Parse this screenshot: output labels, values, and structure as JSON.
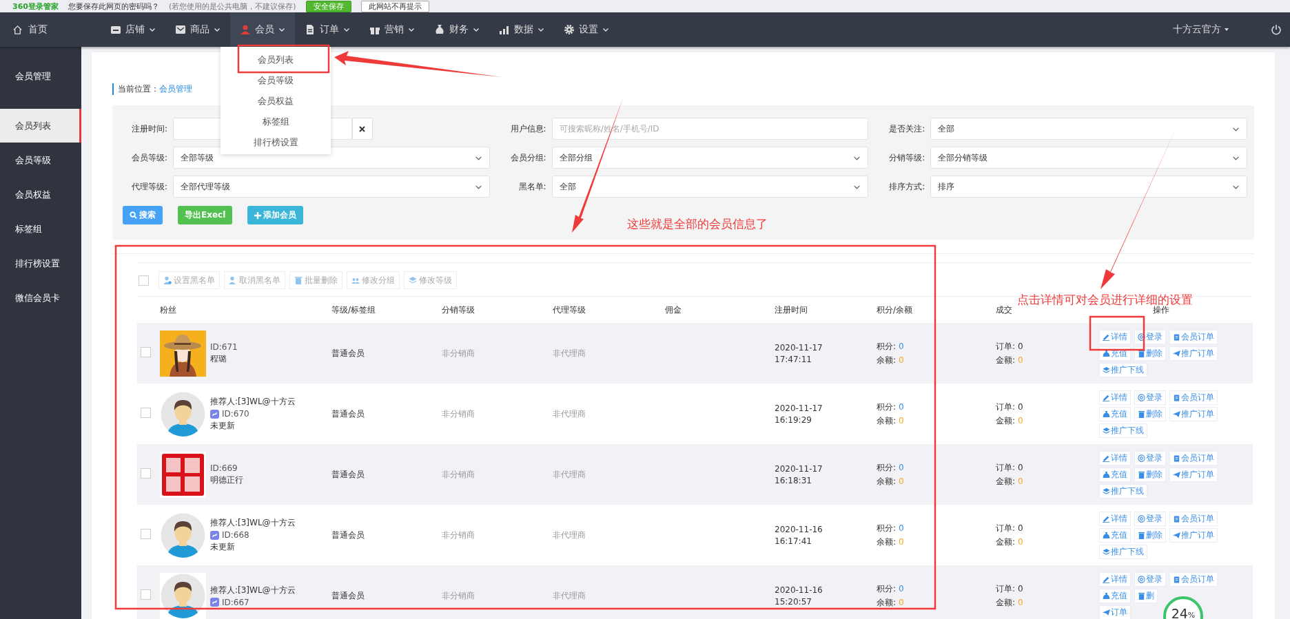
{
  "browser_prompt": {
    "logo": "360登录管家",
    "message": "您要保存此网页的密码吗？",
    "note": "(若您使用的是公共电脑，不建议保存)",
    "buttons": [
      {
        "label": "安全保存",
        "kind": "primary"
      },
      {
        "label": "此网站不再提示",
        "kind": "plain"
      }
    ]
  },
  "nav": {
    "home": "首页",
    "items": [
      {
        "label": "店铺",
        "selected": false
      },
      {
        "label": "商品",
        "selected": false
      },
      {
        "label": "会员",
        "selected": true
      },
      {
        "label": "订单",
        "selected": false
      },
      {
        "label": "营销",
        "selected": false
      },
      {
        "label": "财务",
        "selected": false
      },
      {
        "label": "数据",
        "selected": false
      },
      {
        "label": "设置",
        "selected": false
      }
    ],
    "account": "十方云官方"
  },
  "dropdown": {
    "items": [
      "会员列表",
      "会员等级",
      "会员权益",
      "标签组",
      "排行榜设置"
    ]
  },
  "sidebar": {
    "title": "会员管理",
    "items": [
      {
        "label": "会员列表",
        "selected": true
      },
      {
        "label": "会员等级",
        "selected": false
      },
      {
        "label": "会员权益",
        "selected": false
      },
      {
        "label": "标签组",
        "selected": false
      },
      {
        "label": "排行榜设置",
        "selected": false
      },
      {
        "label": "微信会员卡",
        "selected": false
      }
    ]
  },
  "breadcrumb": {
    "label": "当前位置：",
    "link": "会员管理"
  },
  "filters": [
    {
      "label": "注册时间:",
      "kind": "date"
    },
    {
      "label": "用户信息:",
      "kind": "text",
      "placeholder": "可搜索昵称/姓名/手机号/ID"
    },
    {
      "label": "是否关注:",
      "kind": "select",
      "value": "全部"
    },
    {
      "label": "会员等级:",
      "kind": "select",
      "value": "全部等级"
    },
    {
      "label": "会员分组:",
      "kind": "select",
      "value": "全部分组"
    },
    {
      "label": "分销等级:",
      "kind": "select",
      "value": "全部分销等级"
    },
    {
      "label": "代理等级:",
      "kind": "select",
      "value": "全部代理等级"
    },
    {
      "label": "黑名单:",
      "kind": "select",
      "value": "全部"
    },
    {
      "label": "排序方式:",
      "kind": "select",
      "value": "排序"
    }
  ],
  "filter_buttons": [
    {
      "label": "搜索",
      "kind": "search"
    },
    {
      "label": "导出Execl",
      "kind": "export"
    },
    {
      "label": "添加会员",
      "kind": "add"
    }
  ],
  "toolbar": [
    "设置黑名单",
    "取消黑名单",
    "批量删除",
    "修改分组",
    "修改等级"
  ],
  "table": {
    "select_all_checked": false,
    "columns": [
      "粉丝",
      "等级/标签组",
      "分销等级",
      "代理等级",
      "佣金",
      "注册时间",
      "积分/余额",
      "成交",
      "操作"
    ],
    "rows": [
      {
        "checked": false,
        "mini_program": false,
        "id": "ID:671",
        "name": "程璐",
        "level": "普通会员",
        "distribution": "非分销商",
        "agent": "非代理商",
        "date": "2020-11-17",
        "time": "17:47:11",
        "points_label": "积分:",
        "points": "0",
        "balance_label": "余额:",
        "balance": "0",
        "orders_label": "订单:",
        "orders": "0",
        "amount_label": "金额:",
        "amount": "0",
        "actions": [
          "详情",
          "登录",
          "会员订单",
          "充值",
          "删除",
          "推广订单",
          "推广下线"
        ]
      },
      {
        "checked": false,
        "referrer": "推荐人:[3]WL@十方云",
        "mini_program": true,
        "id": "ID:670",
        "name": "未更新",
        "level": "普通会员",
        "distribution": "非分销商",
        "agent": "非代理商",
        "date": "2020-11-17",
        "time": "16:19:29",
        "points_label": "积分:",
        "points": "0",
        "balance_label": "余额:",
        "balance": "0",
        "orders_label": "订单:",
        "orders": "0",
        "amount_label": "金额:",
        "amount": "0",
        "actions": [
          "详情",
          "登录",
          "会员订单",
          "充值",
          "删除",
          "推广订单",
          "推广下线"
        ]
      },
      {
        "checked": false,
        "mini_program": false,
        "id": "ID:669",
        "name": "明德正行",
        "level": "普通会员",
        "distribution": "非分销商",
        "agent": "非代理商",
        "date": "2020-11-17",
        "time": "16:18:31",
        "points_label": "积分:",
        "points": "0",
        "balance_label": "余额:",
        "balance": "0",
        "orders_label": "订单:",
        "orders": "0",
        "amount_label": "金额:",
        "amount": "0",
        "actions": [
          "详情",
          "登录",
          "会员订单",
          "充值",
          "删除",
          "推广订单",
          "推广下线"
        ]
      },
      {
        "checked": false,
        "referrer": "推荐人:[3]WL@十方云",
        "mini_program": true,
        "id": "ID:668",
        "name": "未更新",
        "level": "普通会员",
        "distribution": "非分销商",
        "agent": "非代理商",
        "date": "2020-11-16",
        "time": "16:17:41",
        "points_label": "积分:",
        "points": "0",
        "balance_label": "余额:",
        "balance": "0",
        "orders_label": "订单:",
        "orders": "0",
        "amount_label": "金额:",
        "amount": "0",
        "actions": [
          "详情",
          "登录",
          "会员订单",
          "充值",
          "删除",
          "推广订单",
          "推广下线"
        ]
      },
      {
        "checked": false,
        "referrer": "推荐人:[3]WL@十方云",
        "mini_program": true,
        "id": "ID:667",
        "level": "普通会员",
        "distribution": "非分销商",
        "agent": "非代理商",
        "date": "2020-11-16",
        "time": "15:20:57",
        "points_label": "积分:",
        "points": "0",
        "balance_label": "余额:",
        "balance": "0",
        "orders_label": "订单:",
        "orders": "0",
        "amount_label": "金额:",
        "amount": "0",
        "actions": [
          "详情",
          "登录",
          "会员订单",
          "充值",
          "删",
          "订单"
        ]
      }
    ]
  },
  "annotations": {
    "list_note": "这些就是全部的会员信息了",
    "detail_note": "点击详情可对会员进行详细的设置"
  },
  "speed_ball": {
    "value": "24",
    "unit": "%"
  }
}
